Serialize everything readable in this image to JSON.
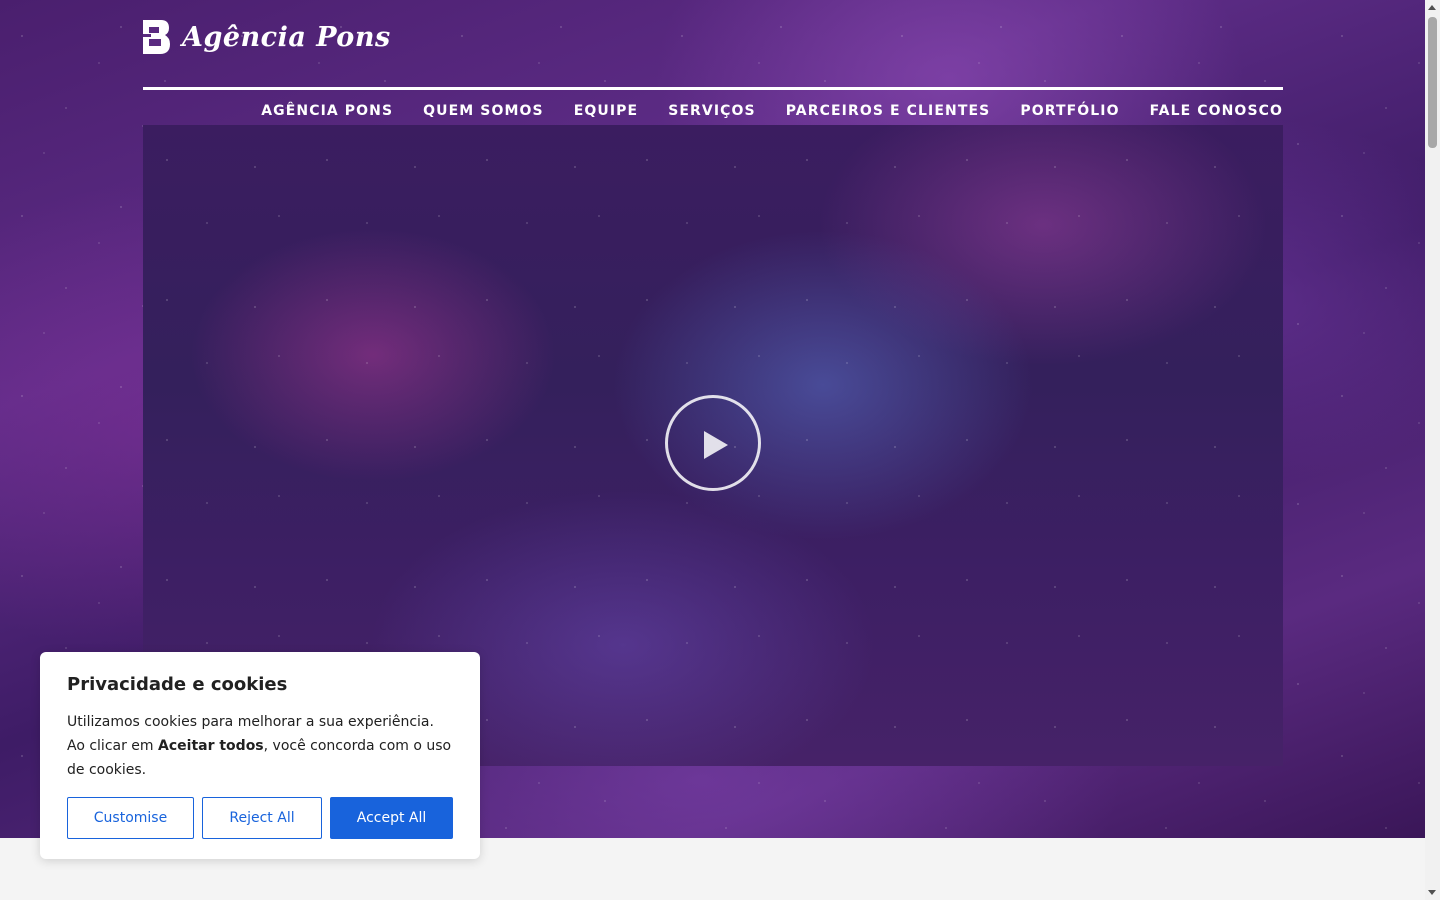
{
  "brand": {
    "name": "Agência Pons"
  },
  "nav": {
    "items": [
      "AGÊNCIA PONS",
      "QUEM SOMOS",
      "EQUIPE",
      "SERVIÇOS",
      "PARCEIROS E CLIENTES",
      "PORTFÓLIO",
      "FALE CONOSCO"
    ]
  },
  "video": {
    "play_icon": "play-icon"
  },
  "cookie": {
    "title": "Privacidade e cookies",
    "text_before": "Utilizamos cookies para melhorar a sua experiência. Ao clicar em ",
    "text_bold": "Aceitar todos",
    "text_after": ", você concorda com o uso de cookies.",
    "customise_label": "Customise",
    "reject_label": "Reject All",
    "accept_label": "Accept All"
  },
  "colors": {
    "accent": "#1863dc",
    "hero_purple": "#4a1f6e"
  }
}
